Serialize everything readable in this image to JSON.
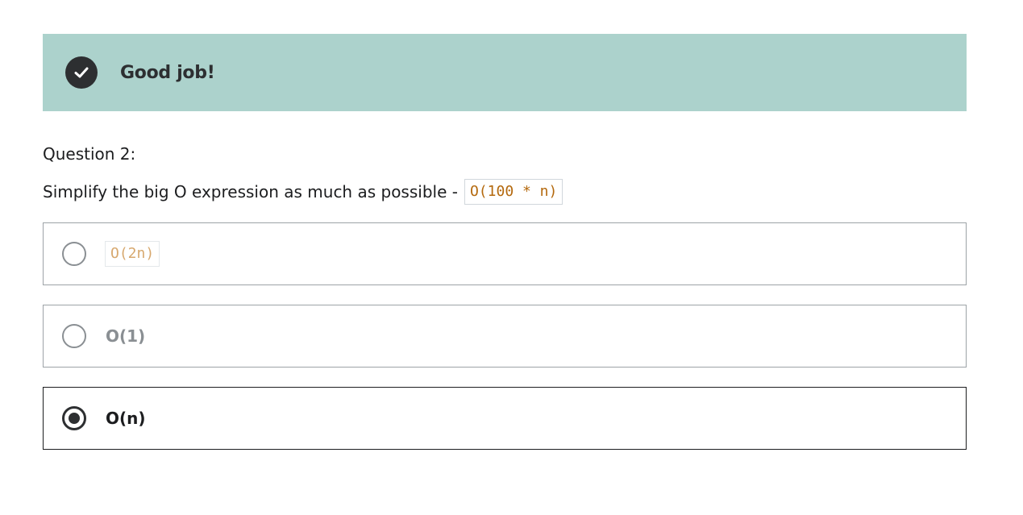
{
  "feedback": {
    "icon": "check-circle-icon",
    "message": "Good job!",
    "background": "#acd2cc"
  },
  "question": {
    "title": "Question 2:",
    "prompt": "Simplify the big O expression as much as possible -",
    "expression": "O(100 * n)"
  },
  "options": [
    {
      "label": "O(2n)",
      "is_code": true,
      "selected": false
    },
    {
      "label": "O(1)",
      "is_code": false,
      "selected": false
    },
    {
      "label": "O(n)",
      "is_code": false,
      "selected": true
    }
  ],
  "colors": {
    "code": "#b4690e",
    "selected_border": "#1c1d1f",
    "unselected_border": "#9da3a7"
  }
}
